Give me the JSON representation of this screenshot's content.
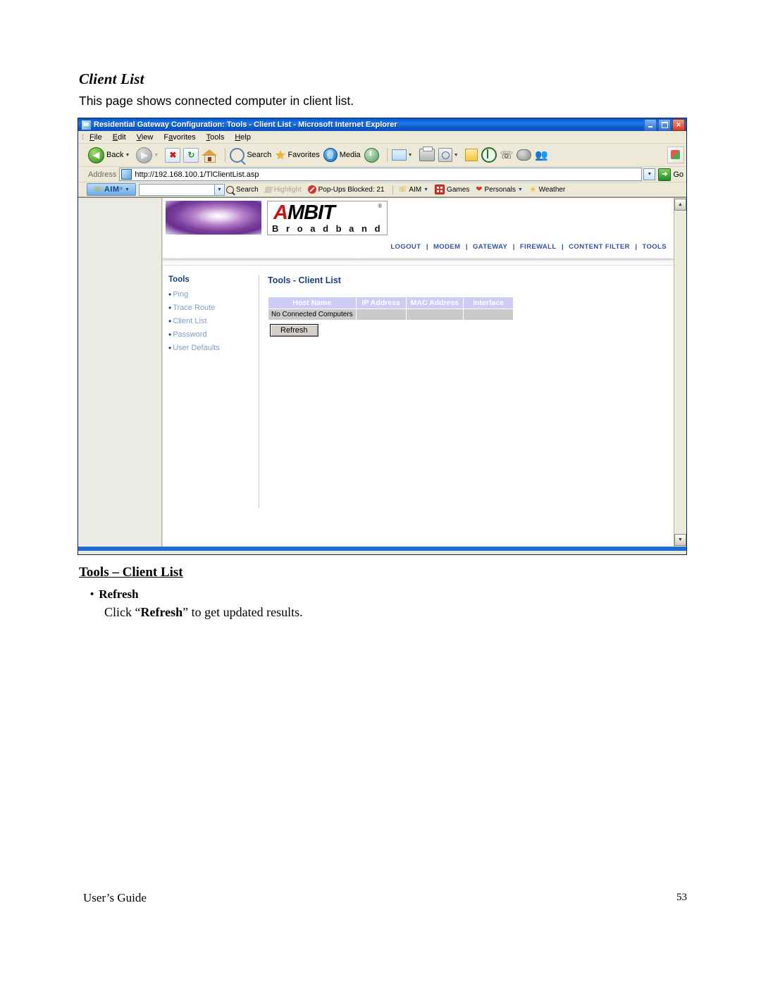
{
  "document": {
    "title": "Client List",
    "subtitle": "This page shows connected computer in client list.",
    "section_title": "Tools – Client List",
    "bullet_label": "Refresh",
    "bullet_dot": "•",
    "body_pre": "Click “",
    "body_bold": "Refresh",
    "body_post": "” to get updated results.",
    "footer_left": "User’s Guide",
    "footer_page": "53"
  },
  "browser": {
    "window_title": "Residential Gateway Configuration: Tools - Client List - Microsoft Internet Explorer",
    "window_controls": {
      "minimize": "minimize-icon",
      "maximize": "maximize-icon",
      "close": "✕"
    },
    "menu": [
      "File",
      "Edit",
      "View",
      "Favorites",
      "Tools",
      "Help"
    ],
    "menu_accel": [
      "F",
      "E",
      "V",
      "a",
      "T",
      "H"
    ],
    "toolbar": {
      "back_label": "Back",
      "forward_label": "",
      "search_label": "Search",
      "favorites_label": "Favorites",
      "media_label": "Media",
      "caret": "▼",
      "back_arrow": "◀",
      "forward_arrow": "▶",
      "stop_glyph": "✖",
      "refresh_glyph": "↻",
      "runner_glyph": "☵",
      "people_glyph": "♟"
    },
    "address": {
      "label": "Address",
      "url": "http://192.168.100.1/TlClientList.asp",
      "dropdown_caret": "▼",
      "go_label": "Go",
      "go_glyph": "➜"
    },
    "aim_bar": {
      "brand": "AIM",
      "brand_reg": "®",
      "brand_caret": "▼",
      "search_value": "",
      "search_caret": "▼",
      "items": [
        {
          "label": "Search",
          "icon": "magnifier-icon",
          "dim": false
        },
        {
          "label": "Highlight",
          "icon": "highlighter-icon",
          "dim": true
        },
        {
          "label": "Pop-Ups Blocked: 21",
          "icon": "block-icon",
          "dim": false
        },
        {
          "label": "AIM",
          "icon": "aim-runner-icon",
          "dim": false,
          "caret": "▼"
        },
        {
          "label": "Games",
          "icon": "games-icon",
          "dim": false
        },
        {
          "label": "Personals",
          "icon": "heart-icon",
          "dim": false,
          "caret": "▼"
        },
        {
          "label": "Weather",
          "icon": "sun-icon",
          "dim": false
        }
      ]
    },
    "scrollbar": {
      "up": "▲",
      "down": "▼"
    }
  },
  "router_page": {
    "logo": {
      "brand": "AMBIT",
      "brand_initial": "A",
      "brand_rest": "MBIT",
      "reg": "®",
      "tagline": "B r o a d b a n d"
    },
    "nav": [
      "LOGOUT",
      "MODEM",
      "GATEWAY",
      "FIREWALL",
      "CONTENT FILTER",
      "TOOLS"
    ],
    "nav_separator": "|",
    "sidebar": {
      "heading": "Tools",
      "bullet": "•",
      "items": [
        "Ping",
        "Trace Route",
        "Client List",
        "Password",
        "User Defaults"
      ]
    },
    "main": {
      "heading": "Tools - Client List",
      "table": {
        "columns": [
          "Host Name",
          "IP Address",
          "MAC Address",
          "Interface"
        ],
        "rows": [
          [
            "No Connected Computers",
            "",
            "",
            ""
          ]
        ]
      },
      "refresh_button": "Refresh"
    }
  }
}
